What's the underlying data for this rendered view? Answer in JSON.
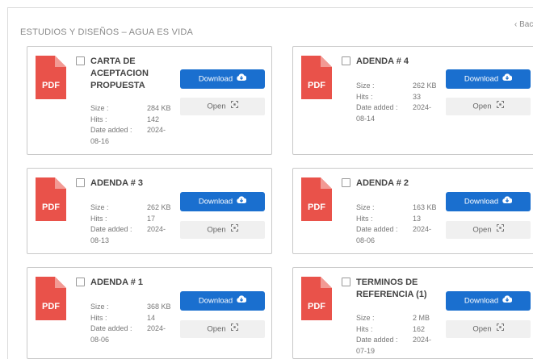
{
  "section": {
    "title": "ESTUDIOS Y DISEÑOS – AGUA ES VIDA",
    "back_label": "‹ Back"
  },
  "labels": {
    "size": "Size :",
    "hits": "Hits :",
    "date": "Date added :"
  },
  "buttons": {
    "download": "Download",
    "open": "Open"
  },
  "icon_text": {
    "pdf": "PDF"
  },
  "colors": {
    "accent": "#1a6fcf",
    "pdf_red": "#e9524a"
  },
  "documents": [
    {
      "title": "CARTA DE ACEPTACION PROPUESTA",
      "size": "284 KB",
      "hits": "142",
      "date_a": "2024-",
      "date_b": "08-16"
    },
    {
      "title": "ADENDA # 4",
      "size": "262 KB",
      "hits": "33",
      "date_a": "2024-",
      "date_b": "08-14"
    },
    {
      "title": "ADENDA # 3",
      "size": "262 KB",
      "hits": "17",
      "date_a": "2024-",
      "date_b": "08-13"
    },
    {
      "title": "ADENDA # 2",
      "size": "163 KB",
      "hits": "13",
      "date_a": "2024-",
      "date_b": "08-06"
    },
    {
      "title": "ADENDA # 1",
      "size": "368 KB",
      "hits": "14",
      "date_a": "2024-",
      "date_b": "08-06"
    },
    {
      "title": "TERMINOS DE REFERENCIA (1)",
      "size": "2 MB",
      "hits": "162",
      "date_a": "2024-",
      "date_b": "07-19"
    }
  ]
}
